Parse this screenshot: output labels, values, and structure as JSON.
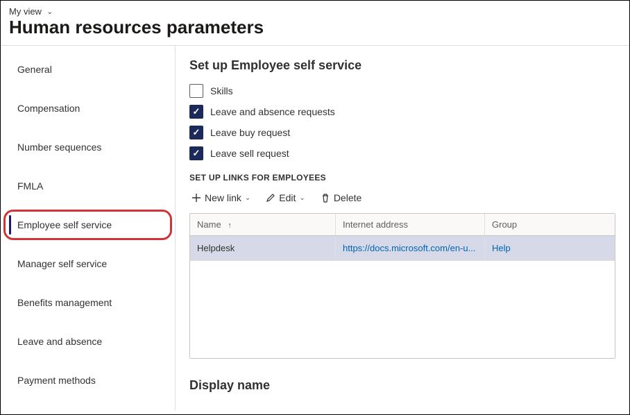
{
  "breadcrumb": {
    "label": "My view"
  },
  "page": {
    "title": "Human resources parameters"
  },
  "sidebar": {
    "items": [
      {
        "label": "General",
        "id": "general"
      },
      {
        "label": "Compensation",
        "id": "compensation"
      },
      {
        "label": "Number sequences",
        "id": "number-sequences"
      },
      {
        "label": "FMLA",
        "id": "fmla"
      },
      {
        "label": "Employee self service",
        "id": "employee-self-service",
        "active": true,
        "highlighted": true
      },
      {
        "label": "Manager self service",
        "id": "manager-self-service"
      },
      {
        "label": "Benefits management",
        "id": "benefits-management"
      },
      {
        "label": "Leave and absence",
        "id": "leave-and-absence"
      },
      {
        "label": "Payment methods",
        "id": "payment-methods"
      }
    ]
  },
  "main": {
    "heading": "Set up Employee self service",
    "checkboxes": [
      {
        "label": "Skills",
        "checked": false
      },
      {
        "label": "Leave and absence requests",
        "checked": true
      },
      {
        "label": "Leave buy request",
        "checked": true
      },
      {
        "label": "Leave sell request",
        "checked": true
      }
    ],
    "links_section_label": "SET UP LINKS FOR EMPLOYEES",
    "toolbar": {
      "new_link": "New link",
      "edit": "Edit",
      "delete": "Delete"
    },
    "grid": {
      "columns": {
        "name": "Name",
        "addr": "Internet address",
        "group": "Group"
      },
      "sort_column": "name",
      "rows": [
        {
          "name": "Helpdesk",
          "addr": "https://docs.microsoft.com/en-u...",
          "group": "Help"
        }
      ]
    },
    "bottom_heading": "Display name"
  }
}
